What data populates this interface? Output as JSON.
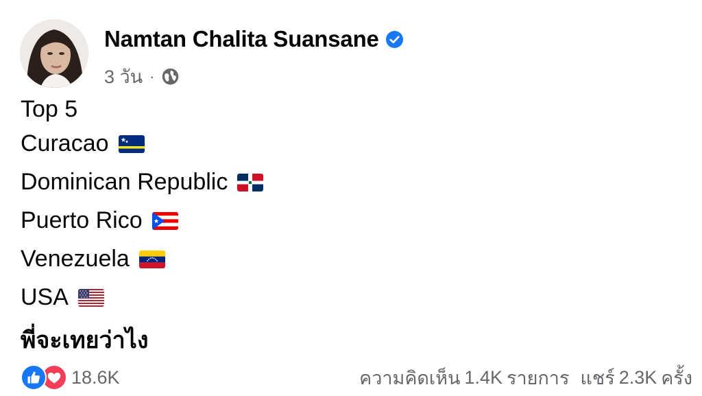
{
  "post": {
    "author_name": "Namtan Chalita Suansane",
    "time": "3 วัน",
    "separator": "·",
    "lines": [
      {
        "text": "Top 5"
      },
      {
        "text": "Curacao",
        "flag": "curacao-flag-icon"
      },
      {
        "text": "Dominican Republic",
        "flag": "dominican-republic-flag-icon"
      },
      {
        "text": "Puerto Rico",
        "flag": "puerto-rico-flag-icon"
      },
      {
        "text": "Venezuela",
        "flag": "venezuela-flag-icon"
      },
      {
        "text": "USA",
        "flag": "usa-flag-icon"
      },
      {
        "text": "พี่จะเทยว่าไง"
      }
    ]
  },
  "footer": {
    "reaction_count": "18.6K",
    "comments_label": "ความคิดเห็น",
    "comments_count": "1.4K",
    "comments_unit": "รายการ",
    "shares_label": "แชร์",
    "shares_count": "2.3K",
    "shares_unit": "ครั้ง"
  },
  "colors": {
    "text": "#050505",
    "secondary": "#65676b",
    "verified": "#1877f2",
    "like": "#1877f2",
    "love": "#f33e58"
  }
}
